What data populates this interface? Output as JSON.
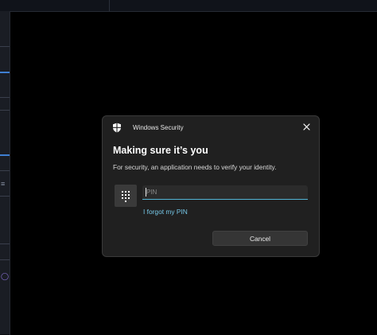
{
  "dialog": {
    "app_title": "Windows Security",
    "heading": "Making sure it’s you",
    "subtext": "For security, an application needs to verify your identity.",
    "pin_field": {
      "placeholder": "PIN",
      "value": ""
    },
    "forgot_link": "I forgot my PIN",
    "cancel_label": "Cancel"
  },
  "icons": {
    "app": "shield-icon",
    "close": "close-icon",
    "pin": "keypad-icon"
  },
  "colors": {
    "accent": "#52b5d6",
    "link": "#76c8e8",
    "dialog_bg": "#202020"
  }
}
